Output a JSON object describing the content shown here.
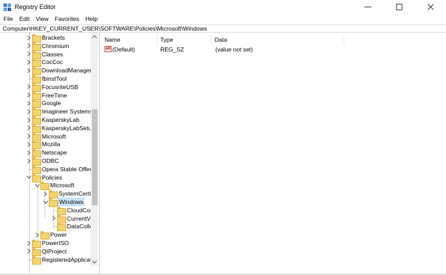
{
  "window": {
    "title": "Registry Editor",
    "accent": "#0078d7"
  },
  "menu": [
    "File",
    "Edit",
    "View",
    "Favorites",
    "Help"
  ],
  "address": "Computer\\HKEY_CURRENT_USER\\SOFTWARE\\Policies\\Microsoft\\Windows",
  "tree": [
    {
      "label": "Brackets",
      "expander": ">"
    },
    {
      "label": "Chromium",
      "expander": ">"
    },
    {
      "label": "Classes",
      "expander": ">"
    },
    {
      "label": "CocCoc",
      "expander": ">"
    },
    {
      "label": "DownloadManager",
      "expander": ">"
    },
    {
      "label": "fbinstTool",
      "expander": ""
    },
    {
      "label": "FocusriteUSB",
      "expander": ">"
    },
    {
      "label": "FreeTime",
      "expander": ">"
    },
    {
      "label": "Google",
      "expander": ">"
    },
    {
      "label": "Imagineer Systems L",
      "expander": ">"
    },
    {
      "label": "KasperskyLab",
      "expander": ">"
    },
    {
      "label": "KasperskyLabSetup",
      "expander": ">"
    },
    {
      "label": "Microsoft",
      "expander": ">"
    },
    {
      "label": "Mozilla",
      "expander": ">"
    },
    {
      "label": "Netscape",
      "expander": ">"
    },
    {
      "label": "ODBC",
      "expander": ">"
    },
    {
      "label": "Opera Stable Offer",
      "expander": ""
    },
    {
      "label": "Policies",
      "expander": "v"
    },
    {
      "label": "Microsoft",
      "expander": "v"
    },
    {
      "label": "SystemCertific",
      "expander": ">"
    },
    {
      "label": "Windows",
      "expander": "v"
    },
    {
      "label": "CloudCont",
      "expander": ""
    },
    {
      "label": "CurrentVers",
      "expander": ">"
    },
    {
      "label": "DataCollect",
      "expander": ""
    },
    {
      "label": "Power",
      "expander": ">"
    },
    {
      "label": "PowerISO",
      "expander": ">"
    },
    {
      "label": "QtProject",
      "expander": ">"
    },
    {
      "label": "RegisteredApplicatio",
      "expander": ""
    }
  ],
  "columns": {
    "name": "Name",
    "type": "Type",
    "data": "Data"
  },
  "values": [
    {
      "icon": "ab",
      "name": "(Default)",
      "type": "REG_SZ",
      "data": "(value not set)"
    }
  ]
}
